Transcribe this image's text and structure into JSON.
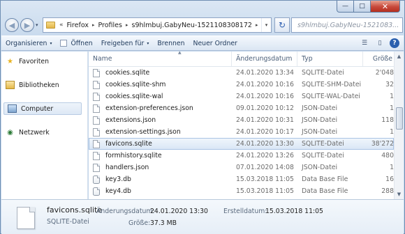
{
  "window": {
    "controls": {
      "minimize": "—",
      "maximize": "□",
      "close": "✕"
    }
  },
  "nav": {
    "back": "◀",
    "forward": "▶",
    "history_dropdown": "▾"
  },
  "address": {
    "overflow": "«",
    "crumbs": [
      "Firefox",
      "Profiles",
      "s9hlmbuj.GabyNeu-1521108308172"
    ],
    "separator": "▸",
    "dropdown": "▾",
    "refresh": "↻",
    "search_placeholder": "s9hlmbuj.GabyNeu-1521083..."
  },
  "commandbar": {
    "organize": "Organisieren",
    "open": "Öffnen",
    "share": "Freigeben für",
    "burn": "Brennen",
    "new_folder": "Neuer Ordner",
    "caret": "▾",
    "help": "?"
  },
  "navpane": {
    "favorites": "Favoriten",
    "libraries": "Bibliotheken",
    "computer": "Computer",
    "network": "Netzwerk"
  },
  "list": {
    "columns": {
      "name": "Name",
      "date": "Änderungsdatum",
      "type": "Typ",
      "size": "Größe"
    },
    "rows": [
      {
        "name": "cookies.sqlite",
        "date": "24.01.2020 13:34",
        "type": "SQLITE-Datei",
        "size": "2'048"
      },
      {
        "name": "cookies.sqlite-shm",
        "date": "24.01.2020 10:16",
        "type": "SQLITE-SHM-Datei",
        "size": "32"
      },
      {
        "name": "cookies.sqlite-wal",
        "date": "24.01.2020 10:16",
        "type": "SQLITE-WAL-Datei",
        "size": "1"
      },
      {
        "name": "extension-preferences.json",
        "date": "09.01.2020 10:12",
        "type": "JSON-Datei",
        "size": "1"
      },
      {
        "name": "extensions.json",
        "date": "24.01.2020 10:31",
        "type": "JSON-Datei",
        "size": "118"
      },
      {
        "name": "extension-settings.json",
        "date": "24.01.2020 10:17",
        "type": "JSON-Datei",
        "size": "1"
      },
      {
        "name": "favicons.sqlite",
        "date": "24.01.2020 13:30",
        "type": "SQLITE-Datei",
        "size": "38'272"
      },
      {
        "name": "formhistory.sqlite",
        "date": "24.01.2020 13:26",
        "type": "SQLITE-Datei",
        "size": "480"
      },
      {
        "name": "handlers.json",
        "date": "07.01.2020 14:08",
        "type": "JSON-Datei",
        "size": "1"
      },
      {
        "name": "key3.db",
        "date": "15.03.2018 11:05",
        "type": "Data Base File",
        "size": "16"
      },
      {
        "name": "key4.db",
        "date": "15.03.2018 11:05",
        "type": "Data Base File",
        "size": "288"
      }
    ],
    "selected_index": 6
  },
  "details": {
    "name": "favicons.sqlite",
    "type": "SQLITE-Datei",
    "modified_label": "Änderungsdatum:",
    "modified_value": "24.01.2020 13:30",
    "size_label": "Größe:",
    "size_value": "37.3 MB",
    "created_label": "Erstelldatum:",
    "created_value": "15.03.2018 11:05"
  },
  "colors": {
    "selection": "#d9e6f5",
    "accent": "#2a5fae",
    "chrome": "#c6d8ec"
  }
}
